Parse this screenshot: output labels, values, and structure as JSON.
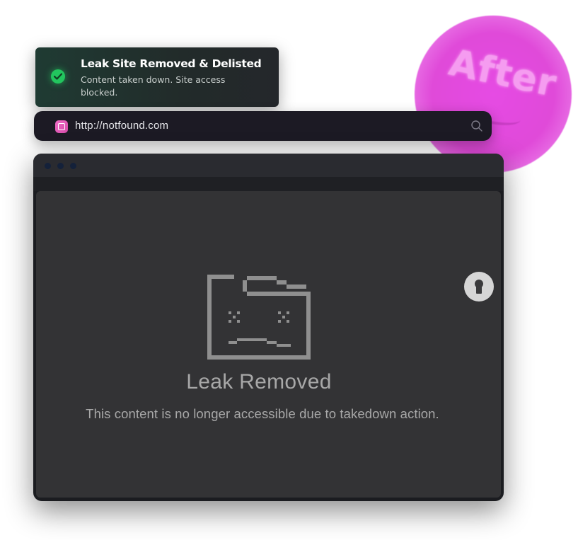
{
  "badge": {
    "label": "After",
    "color": "#e04ad9"
  },
  "toast": {
    "title": "Leak Site Removed & Delisted",
    "description": "Content taken down. Site access blocked.",
    "icon": "check-circle-icon",
    "accent": "#22c55e"
  },
  "urlbar": {
    "url": "http://notfound.com",
    "favicon": "site-favicon-icon",
    "search_icon": "search-icon"
  },
  "browser": {
    "window_dots": [
      "dot",
      "dot",
      "dot"
    ],
    "lock_icon": "keyhole-icon",
    "error_icon": "sad-folder-icon",
    "error_title": "Leak Removed",
    "error_description": "This content is no longer accessible due to takedown action."
  }
}
